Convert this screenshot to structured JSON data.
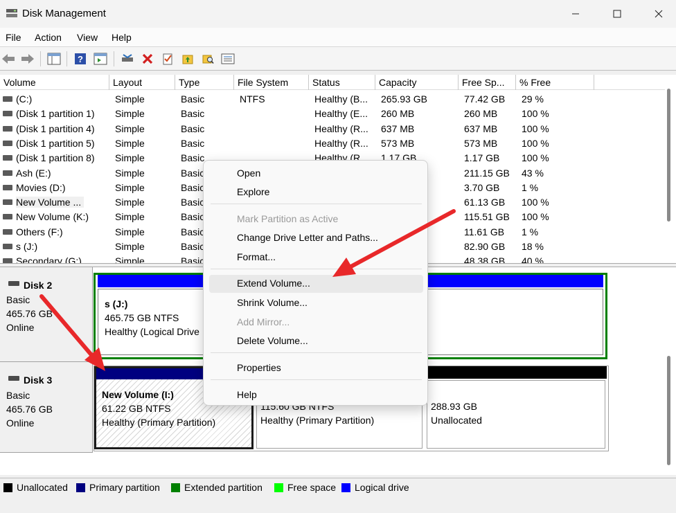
{
  "window": {
    "title": "Disk Management"
  },
  "menu": [
    "File",
    "Action",
    "View",
    "Help"
  ],
  "columns": [
    "Volume",
    "Layout",
    "Type",
    "File System",
    "Status",
    "Capacity",
    "Free Sp...",
    "% Free"
  ],
  "volumes": [
    {
      "volume": "(C:)",
      "layout": "Simple",
      "type": "Basic",
      "fs": "NTFS",
      "status": "Healthy (B...",
      "capacity": "265.93 GB",
      "free": "77.42 GB",
      "pct": "29 %"
    },
    {
      "volume": "(Disk 1 partition 1)",
      "layout": "Simple",
      "type": "Basic",
      "fs": "",
      "status": "Healthy (E...",
      "capacity": "260 MB",
      "free": "260 MB",
      "pct": "100 %"
    },
    {
      "volume": "(Disk 1 partition 4)",
      "layout": "Simple",
      "type": "Basic",
      "fs": "",
      "status": "Healthy (R...",
      "capacity": "637 MB",
      "free": "637 MB",
      "pct": "100 %"
    },
    {
      "volume": "(Disk 1 partition 5)",
      "layout": "Simple",
      "type": "Basic",
      "fs": "",
      "status": "Healthy (R...",
      "capacity": "573 MB",
      "free": "573 MB",
      "pct": "100 %"
    },
    {
      "volume": "(Disk 1 partition 8)",
      "layout": "Simple",
      "type": "Basic",
      "fs": "",
      "status": "Healthy (R...",
      "capacity": "1.17 GB",
      "free": "1.17 GB",
      "pct": "100 %"
    },
    {
      "volume": "Ash (E:)",
      "layout": "Simple",
      "type": "Basic",
      "fs": "",
      "status": "",
      "capacity": "",
      "free": "211.15 GB",
      "pct": "43 %"
    },
    {
      "volume": "Movies (D:)",
      "layout": "Simple",
      "type": "Basic",
      "fs": "",
      "status": "",
      "capacity": "",
      "free": "3.70 GB",
      "pct": "1 %"
    },
    {
      "volume": "New Volume ...",
      "layout": "Simple",
      "type": "Basic",
      "fs": "",
      "status": "",
      "capacity": "",
      "free": "61.13 GB",
      "pct": "100 %"
    },
    {
      "volume": "New Volume (K:)",
      "layout": "Simple",
      "type": "Basic",
      "fs": "",
      "status": "",
      "capacity": "",
      "free": "115.51 GB",
      "pct": "100 %"
    },
    {
      "volume": "Others (F:)",
      "layout": "Simple",
      "type": "Basic",
      "fs": "",
      "status": "",
      "capacity": "",
      "free": "11.61 GB",
      "pct": "1 %"
    },
    {
      "volume": "s (J:)",
      "layout": "Simple",
      "type": "Basic",
      "fs": "",
      "status": "",
      "capacity": "",
      "free": "82.90 GB",
      "pct": "18 %"
    },
    {
      "volume": "Secondary (G:)",
      "layout": "Simple",
      "type": "Basic",
      "fs": "",
      "status": "",
      "capacity": "",
      "free": "48.38 GB",
      "pct": "40 %"
    }
  ],
  "disks": [
    {
      "name": "Disk 2",
      "type": "Basic",
      "size": "465.76 GB",
      "state": "Online",
      "partitions": [
        {
          "name": "s  (J:)",
          "line1": "465.75 GB NTFS",
          "line2": "Healthy (Logical Drive"
        }
      ]
    },
    {
      "name": "Disk 3",
      "type": "Basic",
      "size": "465.76 GB",
      "state": "Online",
      "partitions": [
        {
          "name": "New Volume  (I:)",
          "line1": "61.22 GB NTFS",
          "line2": "Healthy (Primary Partition)"
        },
        {
          "name": "",
          "line1": "115.60 GB NTFS",
          "line2": "Healthy (Primary Partition)"
        },
        {
          "name": "",
          "line1": "288.93 GB",
          "line2": "Unallocated"
        }
      ]
    }
  ],
  "context_menu": {
    "items": [
      {
        "label": "Open",
        "disabled": false
      },
      {
        "label": "Explore",
        "disabled": false
      },
      {
        "label": "Mark Partition as Active",
        "disabled": true
      },
      {
        "label": "Change Drive Letter and Paths...",
        "disabled": false
      },
      {
        "label": "Format...",
        "disabled": false
      },
      {
        "label": "Extend Volume...",
        "disabled": false,
        "highlighted": true
      },
      {
        "label": "Shrink Volume...",
        "disabled": false
      },
      {
        "label": "Add Mirror...",
        "disabled": true
      },
      {
        "label": "Delete Volume...",
        "disabled": false
      },
      {
        "label": "Properties",
        "disabled": false
      },
      {
        "label": "Help",
        "disabled": false
      }
    ]
  },
  "legend": [
    {
      "label": "Unallocated",
      "color": "#000000"
    },
    {
      "label": "Primary partition",
      "color": "#000080"
    },
    {
      "label": "Extended partition",
      "color": "#008000"
    },
    {
      "label": "Free space",
      "color": "#00ff00"
    },
    {
      "label": "Logical drive",
      "color": "#0000ff"
    }
  ],
  "colors": {
    "primary": "#000080",
    "logical": "#0000ff",
    "extended": "#008000",
    "unallocated": "#000000",
    "annotation_arrow": "#e8282a"
  }
}
